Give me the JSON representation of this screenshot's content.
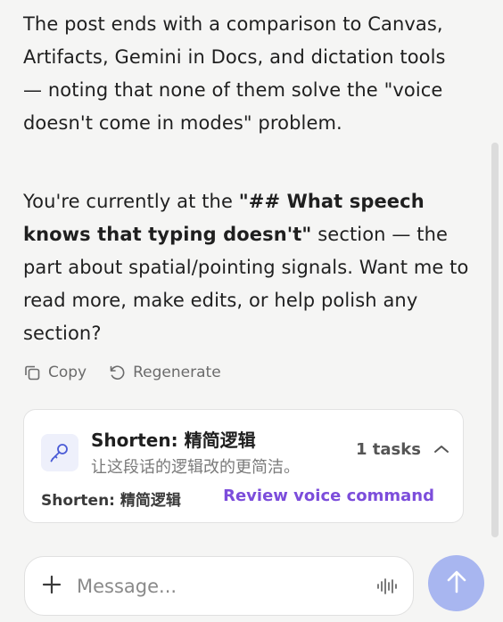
{
  "messages": {
    "p1": "The post ends with a comparison to Canvas, Artifacts, Gemini in Docs, and dictation tools — noting that none of them solve the \"voice doesn't come in modes\" problem.",
    "p2_before": "You're currently at the ",
    "p2_bold": "\"## What speech knows that typing doesn't\"",
    "p2_after": " section — the part about spatial/pointing signals. Want me to read more, make edits, or help polish any section?"
  },
  "actions": {
    "copy_label": "Copy",
    "regenerate_label": "Regenerate"
  },
  "task_card": {
    "title": "Shorten: 精简逻辑",
    "subtitle": "让这段话的逻辑改的更简洁。",
    "count_label": "1 tasks",
    "footer_label": "Shorten: 精简逻辑",
    "review_label": "Review voice command"
  },
  "composer": {
    "placeholder": "Message..."
  },
  "colors": {
    "background": "#f5f5f4",
    "accent_purple": "#7c4ddb",
    "send_button": "#a8b6f0"
  },
  "icons": {
    "copy": "copy-icon",
    "regenerate": "regenerate-icon",
    "task": "microphone-icon",
    "collapse": "chevron-up-icon",
    "add": "plus-icon",
    "voice": "waveform-icon",
    "send": "arrow-up-icon"
  }
}
